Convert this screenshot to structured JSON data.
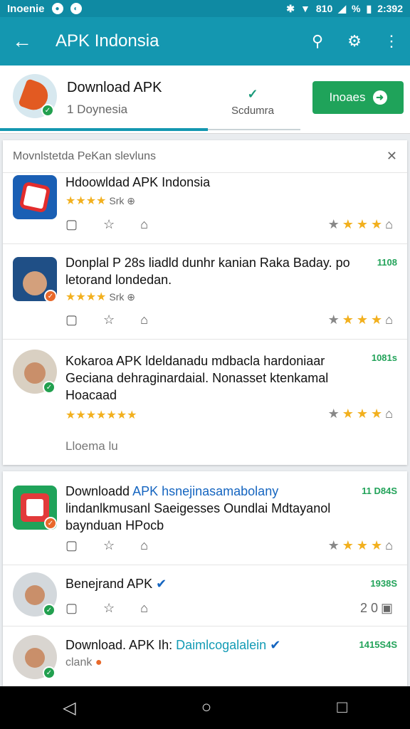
{
  "status_bar": {
    "carrier": "Inoenie",
    "signal_text": "810",
    "battery_text": "%",
    "time": "2:392"
  },
  "app_bar": {
    "title": "APK Indonsia"
  },
  "header": {
    "title": "Download APK",
    "subtitle": "1 Doynesia",
    "middle_label": "Sсdumra",
    "install_label": "Inoaes"
  },
  "card1": {
    "heading": "Movnlstetda PеKan slevluns",
    "items": [
      {
        "title": "Hdoowldad APK Indonsia",
        "stars": "★★★★",
        "meta": "Srk ⊕"
      },
      {
        "title": "Donplal P 28s liadld dunhr kanian Raka Baday. po letorand londedan.",
        "date": "1108",
        "stars": "★★★★",
        "meta": "Srk ⊕"
      },
      {
        "title": "Kokaroa APK ldeldanadu mdbacla hardoniaar Geciana dehraginardaial. Nonasset ktenkamal Hoacaad",
        "date": "1081s",
        "stars": "★★★★★★★"
      }
    ],
    "more": "Lloema lu"
  },
  "card2": {
    "items": [
      {
        "title_a": "Downloadd ",
        "title_b": "APK hsnejinasamabolany",
        "title_c": " lindanlkmusanl Saeigesses Oundlai Mdtayanol baynduan HPocb",
        "date": "11 D84S"
      },
      {
        "title": "Benejrand APK",
        "date": "1938S",
        "right_text": "2 0"
      },
      {
        "title_a": "Download. APK Ih: ",
        "title_b": "Daimlcogalalein",
        "date": "1415S4S",
        "sub": "clank"
      }
    ]
  },
  "colors": {
    "primary": "#1497b0",
    "install": "#1fa35a",
    "star": "#f2b01e"
  }
}
